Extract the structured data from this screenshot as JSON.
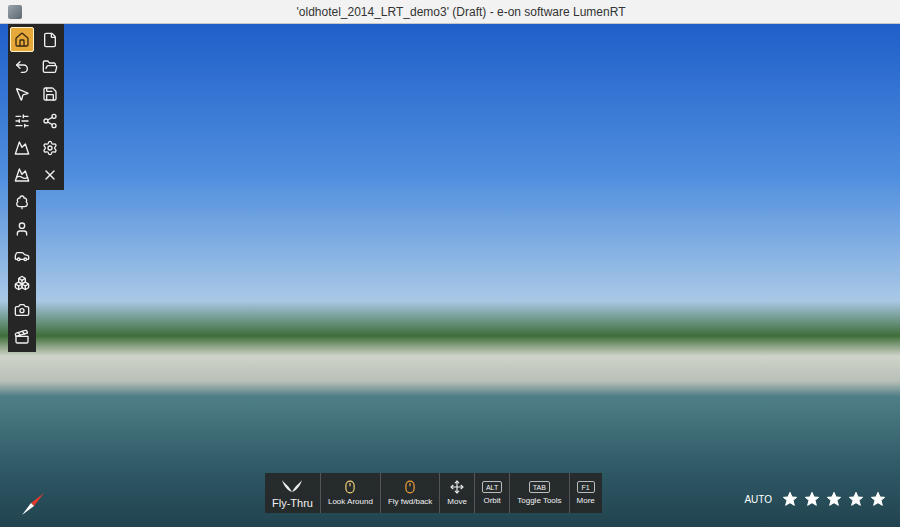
{
  "window": {
    "title": "'oldhotel_2014_LRT_demo3' (Draft) - e-on software LumenRT"
  },
  "toolbar": {
    "primary": [
      {
        "selected": true
      },
      {
        "selected": false
      },
      {
        "selected": false
      },
      {
        "selected": false
      },
      {
        "selected": false
      },
      {
        "selected": false
      },
      {
        "selected": false
      },
      {
        "selected": false
      },
      {
        "selected": false
      },
      {
        "selected": false
      },
      {
        "selected": false
      },
      {
        "selected": false
      }
    ],
    "secondary": [
      {
        "selected": false
      },
      {
        "selected": false
      },
      {
        "selected": false
      },
      {
        "selected": false
      },
      {
        "selected": false
      },
      {
        "selected": false
      }
    ]
  },
  "hints": [
    {
      "label": "Fly-Thru",
      "kind": "mode"
    },
    {
      "label": "Look Around",
      "kind": "mouse"
    },
    {
      "label": "Fly fwd/back",
      "kind": "wheel"
    },
    {
      "label": "Move",
      "kind": "arrows"
    },
    {
      "label": "Orbit",
      "kind": "key",
      "key": "ALT"
    },
    {
      "label": "Toggle Tools",
      "kind": "key",
      "key": "TAB"
    },
    {
      "label": "More",
      "kind": "key",
      "key": "F1"
    }
  ],
  "quality": {
    "label": "AUTO",
    "stars": 5,
    "max": 5
  }
}
